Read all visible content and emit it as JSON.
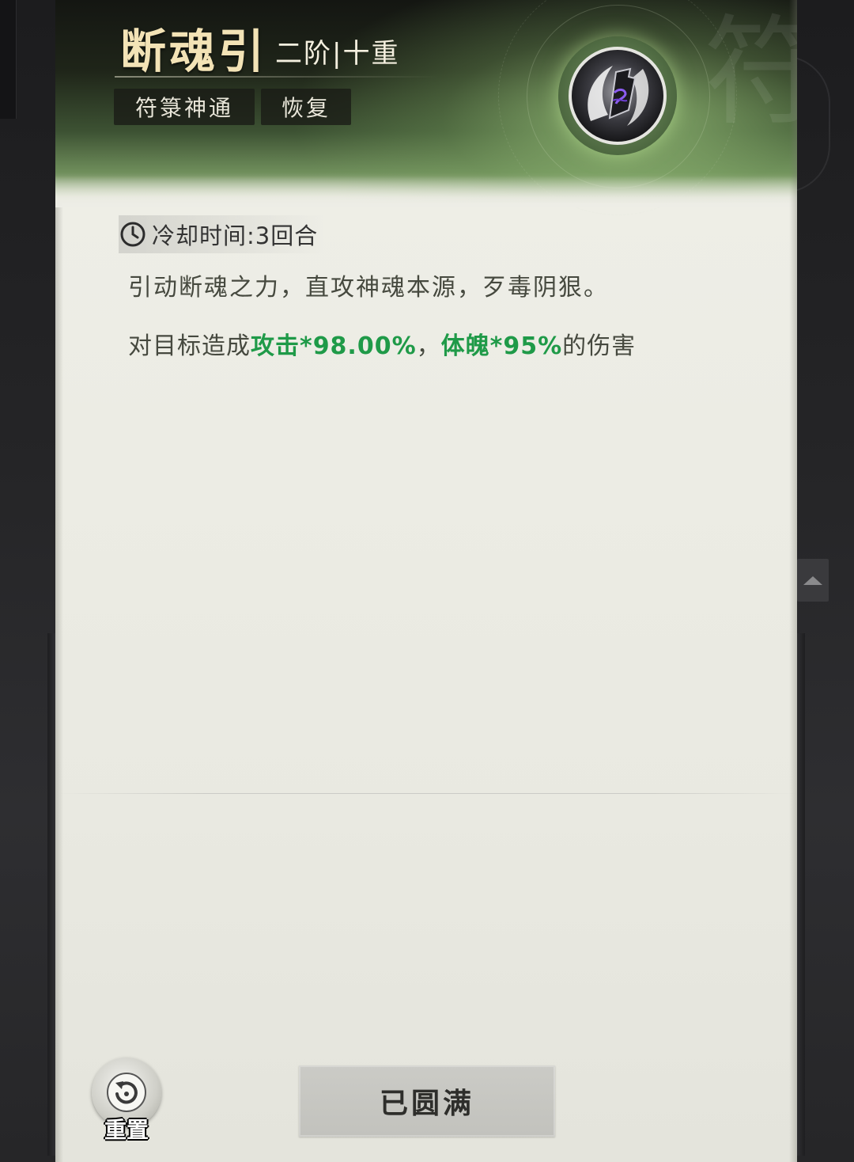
{
  "skill": {
    "name": "断魂引",
    "rank": "二阶|十重",
    "tags": {
      "type": "符箓神通",
      "category": "恢复"
    },
    "watermark": "符",
    "icon": "soul-severing-talisman-icon"
  },
  "details": {
    "cooldown": "冷却时间:3回合",
    "description": "引动断魂之力，直攻神魂本源，歹毒阴狠。",
    "effect": {
      "prefix": "对目标造成",
      "attack": "攻击*98.00%",
      "separator": "，",
      "physique": "体魄*95%",
      "suffix": "的伤害"
    }
  },
  "actions": {
    "reset_label": "重置",
    "maxed_label": "已圆满"
  },
  "colors": {
    "title": "#f3e3b6",
    "highlight_green": "#1f9a48",
    "body_text": "#46493f"
  }
}
